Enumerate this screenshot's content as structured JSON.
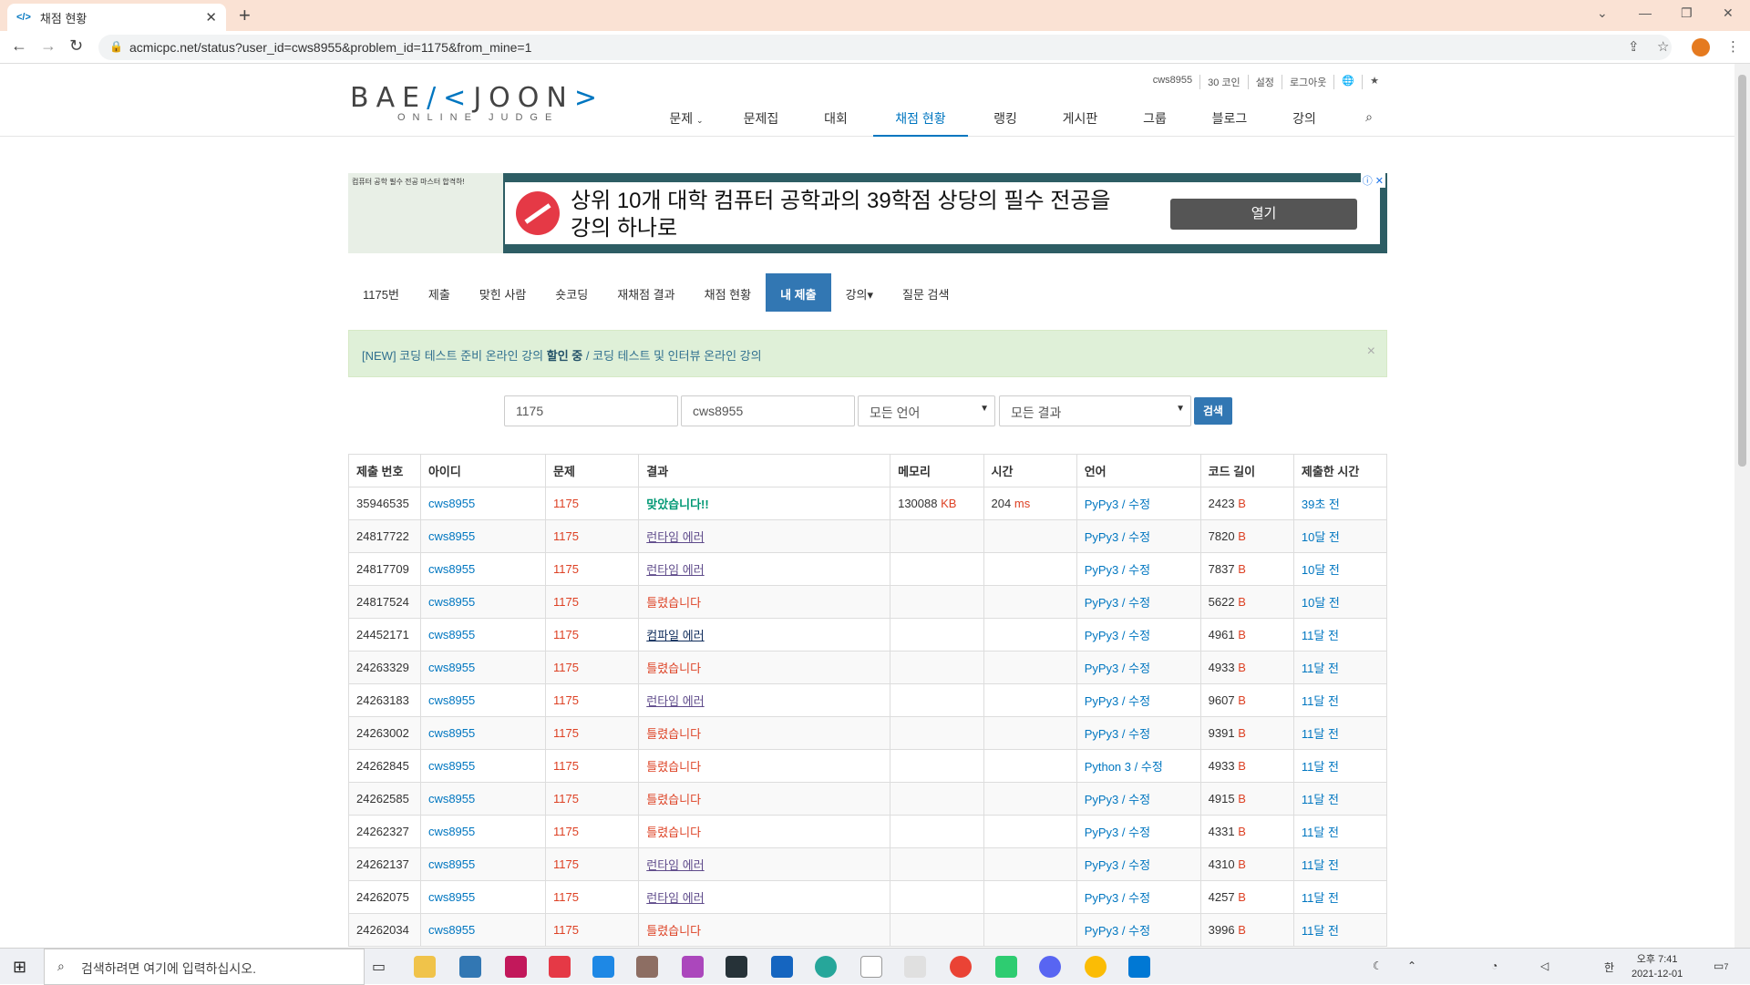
{
  "browser": {
    "tab_title": "채점 현황",
    "url": "acmicpc.net/status?user_id=cws8955&problem_id=1175&from_mine=1"
  },
  "header": {
    "logo_main": "BAEKJOON",
    "logo_sub": "ONLINE JUDGE",
    "toplinks": [
      "cws8955",
      "30 코인",
      "설정",
      "로그아웃"
    ],
    "nav": [
      "문제",
      "문제집",
      "대회",
      "채점 현황",
      "랭킹",
      "게시판",
      "그룹",
      "블로그",
      "강의"
    ]
  },
  "ad": {
    "text1": "상위 10개 대학 컴퓨터 공학과의 39학점 상당의 필수 전공을",
    "text2": "강의 하나로",
    "button": "열기",
    "left_text": "컴퓨터 공학 필수 전공 마스터 합격하!"
  },
  "subnav": [
    "1175번",
    "제출",
    "맞힌 사람",
    "숏코딩",
    "재채점 결과",
    "채점 현황",
    "내 제출",
    "강의▾",
    "질문 검색"
  ],
  "alert": {
    "prefix": "[NEW] 코딩 테스트 준비 온라인 강의 ",
    "bold": "할인 중",
    "suffix": " / 코딩 테스트 및 인터뷰 온라인 강의"
  },
  "filters": {
    "problem": "1175",
    "user": "cws8955",
    "language": "모든 언어",
    "result": "모든 결과",
    "search": "검색"
  },
  "table": {
    "headers": [
      "제출 번호",
      "아이디",
      "문제",
      "결과",
      "메모리",
      "시간",
      "언어",
      "코드 길이",
      "제출한 시간"
    ],
    "rows": [
      [
        "35946535",
        "cws8955",
        "1175",
        "맞았습니다!!",
        "130088",
        "204",
        "PyPy3",
        "2423",
        "39초 전",
        "green"
      ],
      [
        "24817722",
        "cws8955",
        "1175",
        "런타임 에러",
        "",
        "",
        "PyPy3",
        "7820",
        "10달 전",
        "purple"
      ],
      [
        "24817709",
        "cws8955",
        "1175",
        "런타임 에러",
        "",
        "",
        "PyPy3",
        "7837",
        "10달 전",
        "purple"
      ],
      [
        "24817524",
        "cws8955",
        "1175",
        "틀렸습니다",
        "",
        "",
        "PyPy3",
        "5622",
        "10달 전",
        "red"
      ],
      [
        "24452171",
        "cws8955",
        "1175",
        "컴파일 에러",
        "",
        "",
        "PyPy3",
        "4961",
        "11달 전",
        "navy"
      ],
      [
        "24263329",
        "cws8955",
        "1175",
        "틀렸습니다",
        "",
        "",
        "PyPy3",
        "4933",
        "11달 전",
        "red"
      ],
      [
        "24263183",
        "cws8955",
        "1175",
        "런타임 에러",
        "",
        "",
        "PyPy3",
        "9607",
        "11달 전",
        "purple"
      ],
      [
        "24263002",
        "cws8955",
        "1175",
        "틀렸습니다",
        "",
        "",
        "PyPy3",
        "9391",
        "11달 전",
        "red"
      ],
      [
        "24262845",
        "cws8955",
        "1175",
        "틀렸습니다",
        "",
        "",
        "Python 3",
        "4933",
        "11달 전",
        "red"
      ],
      [
        "24262585",
        "cws8955",
        "1175",
        "틀렸습니다",
        "",
        "",
        "PyPy3",
        "4915",
        "11달 전",
        "red"
      ],
      [
        "24262327",
        "cws8955",
        "1175",
        "틀렸습니다",
        "",
        "",
        "PyPy3",
        "4331",
        "11달 전",
        "red"
      ],
      [
        "24262137",
        "cws8955",
        "1175",
        "런타임 에러",
        "",
        "",
        "PyPy3",
        "4310",
        "11달 전",
        "purple"
      ],
      [
        "24262075",
        "cws8955",
        "1175",
        "런타임 에러",
        "",
        "",
        "PyPy3",
        "4257",
        "11달 전",
        "purple"
      ],
      [
        "24262034",
        "cws8955",
        "1175",
        "틀렸습니다",
        "",
        "",
        "PyPy3",
        "3996",
        "11달 전",
        "red"
      ]
    ],
    "edit_label": "수정",
    "unit_kb": "KB",
    "unit_ms": "ms",
    "unit_b": "B"
  },
  "taskbar": {
    "search_placeholder": "검색하려면 여기에 입력하십시오.",
    "time": "오후 7:41",
    "date": "2021-12-01",
    "ime": "한",
    "badge": "7"
  }
}
